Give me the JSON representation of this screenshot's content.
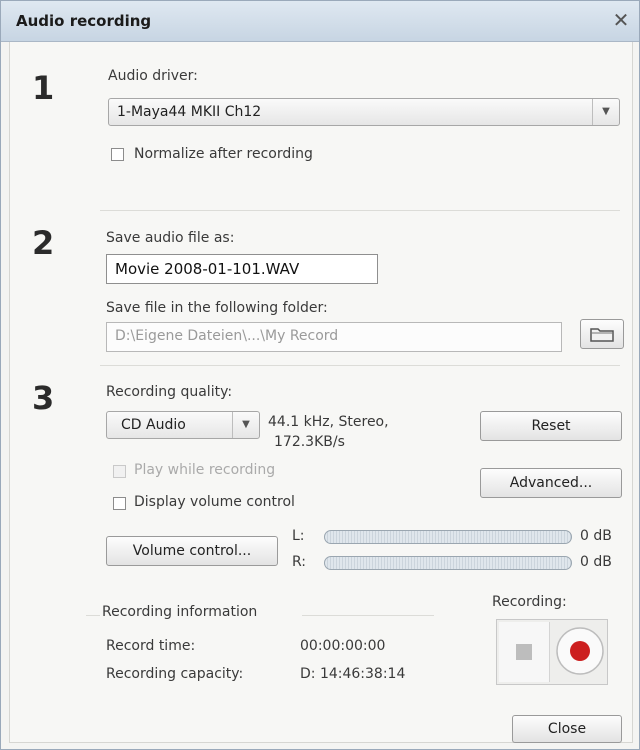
{
  "window": {
    "title": "Audio recording",
    "close_glyph": "✕"
  },
  "step1": {
    "number": "1",
    "driver_label": "Audio driver:",
    "driver_value": "1-Maya44 MKII Ch12",
    "normalize_label": "Normalize after recording"
  },
  "step2": {
    "number": "2",
    "save_as_label": "Save audio file as:",
    "filename": "Movie 2008-01-101.WAV",
    "folder_label": "Save file in the following folder:",
    "folder_path": "D:\\Eigene Dateien\\...\\My Record"
  },
  "step3": {
    "number": "3",
    "quality_label": "Recording quality:",
    "quality_value": "CD Audio",
    "quality_desc_line1": "44.1 kHz, Stereo,",
    "quality_desc_line2": "172.3KB/s",
    "reset_label": "Reset",
    "play_while_label": "Play while recording",
    "advanced_label": "Advanced...",
    "display_volume_label": "Display volume control",
    "volume_button_label": "Volume control...",
    "left_channel_label": "L:",
    "right_channel_label": "R:",
    "left_level": "0 dB",
    "right_level": "0 dB"
  },
  "info": {
    "heading": "Recording information",
    "record_time_label": "Record time:",
    "record_time_value": "00:00:00:00",
    "capacity_label": "Recording capacity:",
    "capacity_value": "D: 14:46:38:14"
  },
  "recording": {
    "heading": "Recording:"
  },
  "footer": {
    "close_label": "Close"
  },
  "colors": {
    "record_red": "#cc1f1f",
    "title_bar": "#cfdbe7"
  },
  "icons": {
    "folder": "folder-icon",
    "stop": "stop-icon",
    "record": "record-icon",
    "dropdown": "chevron-down-icon"
  }
}
